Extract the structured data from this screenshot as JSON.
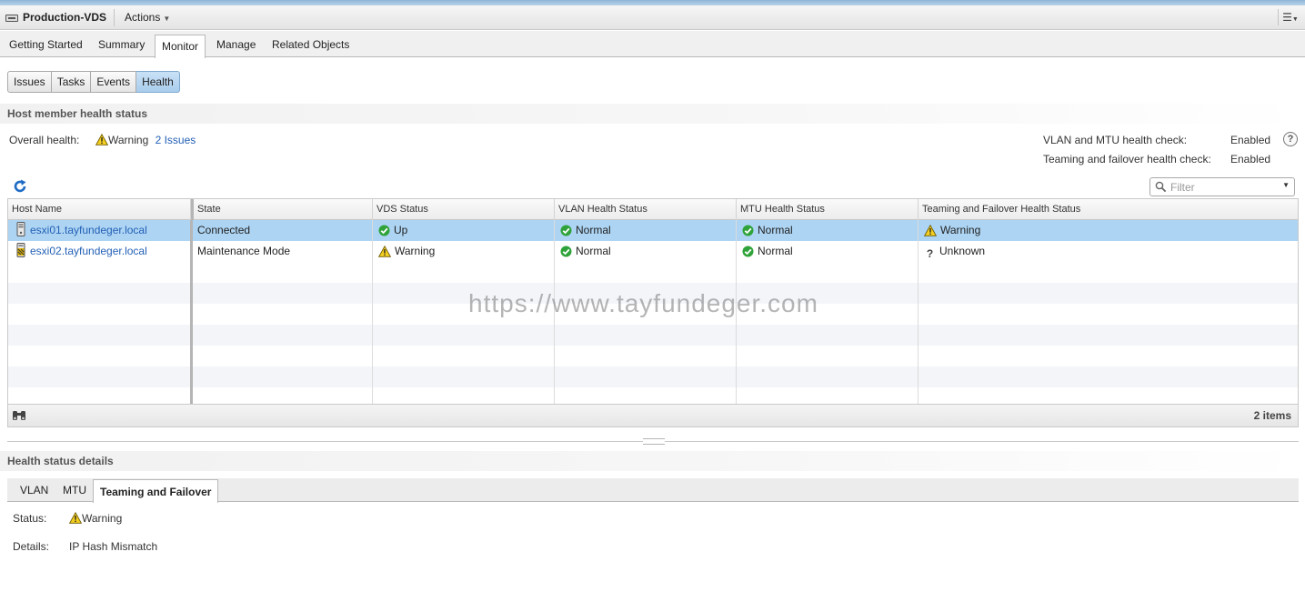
{
  "window": {
    "object_name": "Production-VDS",
    "actions_label": "Actions",
    "menu_icon": "list-menu-icon"
  },
  "tabs": [
    {
      "label": "Getting Started"
    },
    {
      "label": "Summary"
    },
    {
      "label": "Monitor",
      "active": true
    },
    {
      "label": "Manage"
    },
    {
      "label": "Related Objects"
    }
  ],
  "subtabs": [
    {
      "label": "Issues"
    },
    {
      "label": "Tasks"
    },
    {
      "label": "Events"
    },
    {
      "label": "Health",
      "active": true
    }
  ],
  "host_health": {
    "section_title": "Host member health status",
    "overall_label": "Overall health:",
    "overall_value": "Warning",
    "issues_link": "2 Issues",
    "vlan_mtu_label": "VLAN and MTU health check:",
    "vlan_mtu_value": "Enabled",
    "teaming_label": "Teaming and failover health check:",
    "teaming_value": "Enabled",
    "filter_placeholder": "Filter"
  },
  "grid": {
    "columns": [
      "Host Name",
      "State",
      "VDS Status",
      "VLAN Health Status",
      "MTU Health Status",
      "Teaming and Failover Health Status"
    ],
    "rows": [
      {
        "host": "esxi01.tayfundeger.local",
        "state": "Connected",
        "vds": "Up",
        "vlan": "Normal",
        "mtu": "Normal",
        "teaming": "Warning",
        "selected": true
      },
      {
        "host": "esxi02.tayfundeger.local",
        "state": "Maintenance Mode",
        "vds": "Warning",
        "vlan": "Normal",
        "mtu": "Normal",
        "teaming": "Unknown"
      }
    ],
    "item_count": "2 items"
  },
  "watermark": "https://www.tayfundeger.com",
  "details": {
    "section_title": "Health status details",
    "tabs": [
      {
        "label": "VLAN"
      },
      {
        "label": "MTU"
      },
      {
        "label": "Teaming and Failover",
        "active": true
      }
    ],
    "status_label": "Status:",
    "status_value": "Warning",
    "details_label": "Details:",
    "details_value": "IP Hash Mismatch"
  },
  "colors": {
    "link": "#2461b6",
    "selected_row": "#add4f3",
    "ok_green": "#2fa33a",
    "warning_yellow": "#f2c100"
  }
}
